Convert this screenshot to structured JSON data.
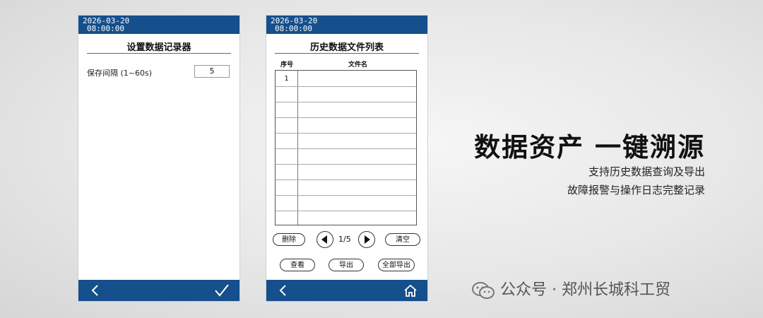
{
  "left_screen": {
    "status_date": "2026-03-20",
    "status_time": "08:00:00",
    "title": "设置数据记录器",
    "setting_label": "保存间隔 (1~60s)",
    "setting_value": "5"
  },
  "right_screen": {
    "status_date": "2026-03-20",
    "status_time": "08:00:00",
    "title": "历史数据文件列表",
    "columns": [
      "序号",
      "文件名"
    ],
    "rows": [
      "1",
      "",
      "",
      "",
      "",
      "",
      "",
      "",
      "",
      ""
    ],
    "page_indicator": "1/5",
    "buttons": {
      "delete": "删除",
      "clear": "清空",
      "view": "查看",
      "export": "导出",
      "export_all": "全部导出"
    }
  },
  "promo": {
    "headline": "数据资产 一键溯源",
    "line1": "支持历史数据查询及导出",
    "line2": "故障报警与操作日志完整记录"
  },
  "footer": {
    "account": "公众号 · 郑州长城科工贸"
  },
  "icons": {
    "back": "chevron-left-icon",
    "confirm": "check-icon",
    "home": "home-icon",
    "prev": "triangle-left-icon",
    "next": "triangle-right-icon",
    "wechat": "wechat-icon"
  },
  "colors": {
    "bar": "#154f8c",
    "background": "#e7e7e7"
  }
}
